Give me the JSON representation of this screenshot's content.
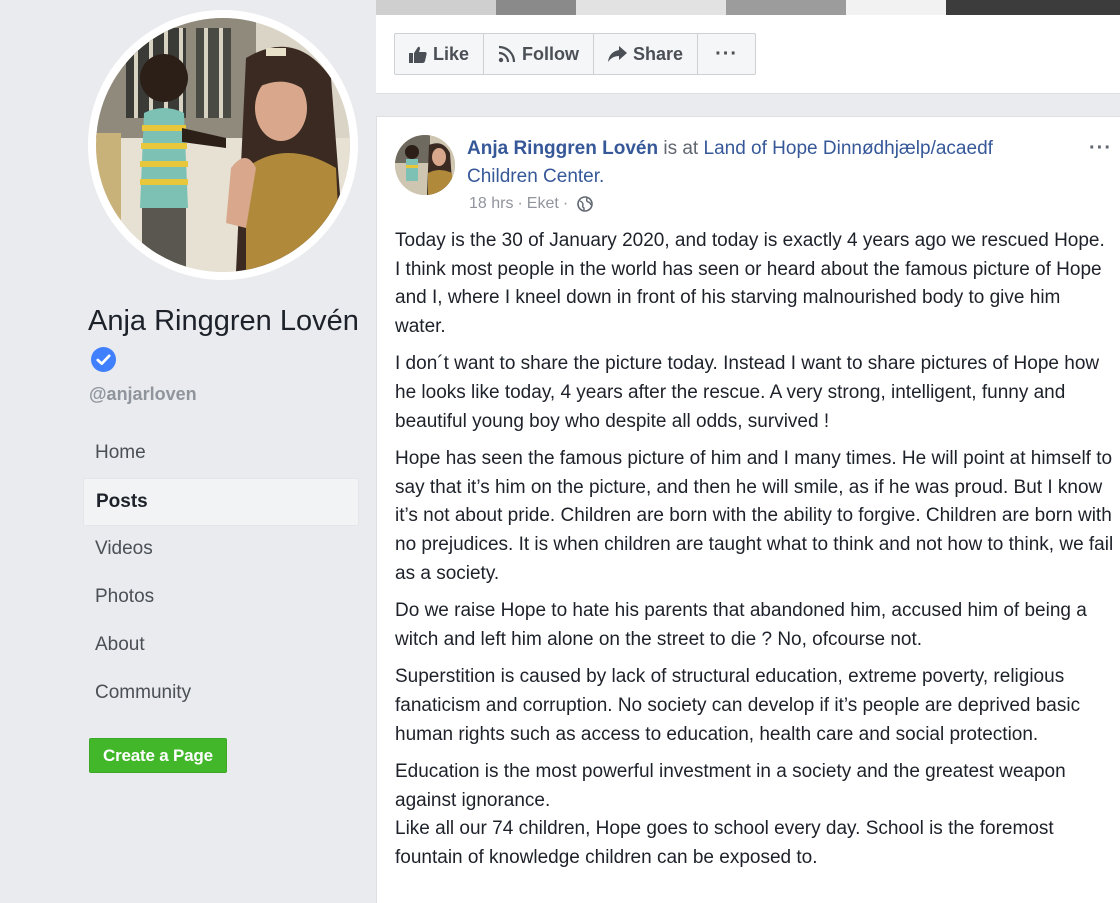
{
  "profile": {
    "name": "Anja Ringgren Lovén",
    "handle": "@anjarloven"
  },
  "nav": {
    "items": [
      {
        "label": "Home"
      },
      {
        "label": "Posts"
      },
      {
        "label": "Videos"
      },
      {
        "label": "Photos"
      },
      {
        "label": "About"
      },
      {
        "label": "Community"
      }
    ],
    "active": "Posts"
  },
  "create_page_label": "Create a Page",
  "actions": {
    "like": "Like",
    "follow": "Follow",
    "share": "Share",
    "more": "···"
  },
  "post": {
    "author": "Anja Ringgren Lovén",
    "is_at": "is at",
    "location": "Land of Hope Dinnødhjælp/acaedf Children Center.",
    "time": "18 hrs",
    "place": "Eket",
    "separator": "·",
    "menu": "···",
    "paragraphs": [
      "Today is the 30 of January 2020, and today is exactly 4 years ago we rescued Hope. I think most people in the world has seen or heard about the famous picture of Hope and I, where I kneel down in front of his starving malnourished body to give him water.",
      "I don´t want to share the picture today. Instead I want to share pictures of Hope how he looks like today, 4 years after the rescue. A very strong, intelligent, funny and beautiful young boy who despite all odds, survived !",
      "Hope has seen the famous picture of him and I many times. He will point at himself to say that it’s him on the picture, and then he will smile, as if he was proud. But I know it’s not about pride. Children are born with the ability to forgive. Children are born with no prejudices. It is when children are taught what to think and not how to think, we fail as a society.",
      "Do we raise Hope to hate his parents that abandoned him, accused him of being a witch and left him alone on the street to die ? No, ofcourse not.",
      "Superstition is caused by lack of structural education, extreme poverty, religious fanaticism and corruption. No society can develop if it’s people are deprived basic human rights such as access to education, health care and social protection.",
      "Education is the most powerful investment in a society and the greatest weapon against ignorance.\nLike all our 74 children, Hope goes to school every day. School is the foremost fountain of knowledge children can be exposed to."
    ]
  },
  "colors": {
    "link": "#365899",
    "green": "#42b72a",
    "verified": "#4080ff",
    "bg": "#e9ebee"
  }
}
